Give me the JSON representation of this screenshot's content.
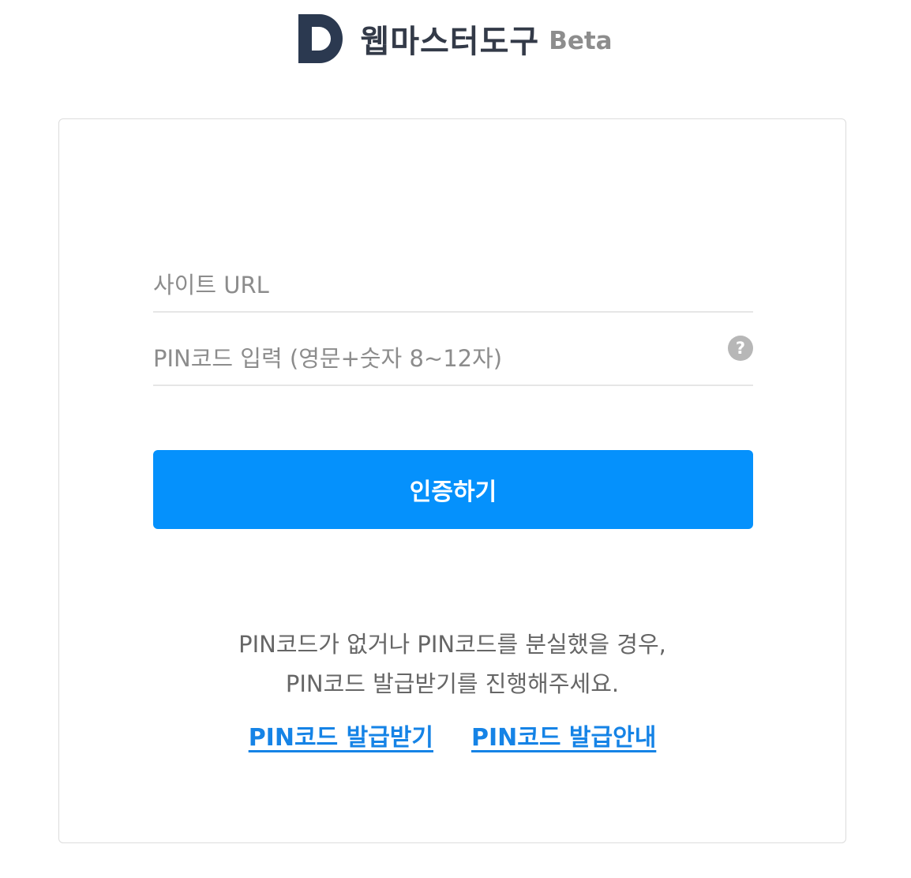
{
  "header": {
    "logo_icon": "d-logo-icon",
    "brand_name": "웹마스터도구",
    "beta_label": "Beta"
  },
  "form": {
    "site_url_placeholder": "사이트 URL",
    "pin_placeholder": "PIN코드 입력 (영문+숫자 8~12자)",
    "help_icon": "question-circle-icon",
    "help_glyph": "?",
    "submit_label": "인증하기"
  },
  "info": {
    "line1": "PIN코드가 없거나 PIN코드를 분실했을 경우,",
    "line2": "PIN코드 발급받기를 진행해주세요."
  },
  "links": {
    "issue_pin": "PIN코드 발급받기",
    "pin_guide": "PIN코드 발급안내"
  },
  "colors": {
    "accent": "#0591fc",
    "link": "#1583e6",
    "logo": "#2b3950"
  }
}
